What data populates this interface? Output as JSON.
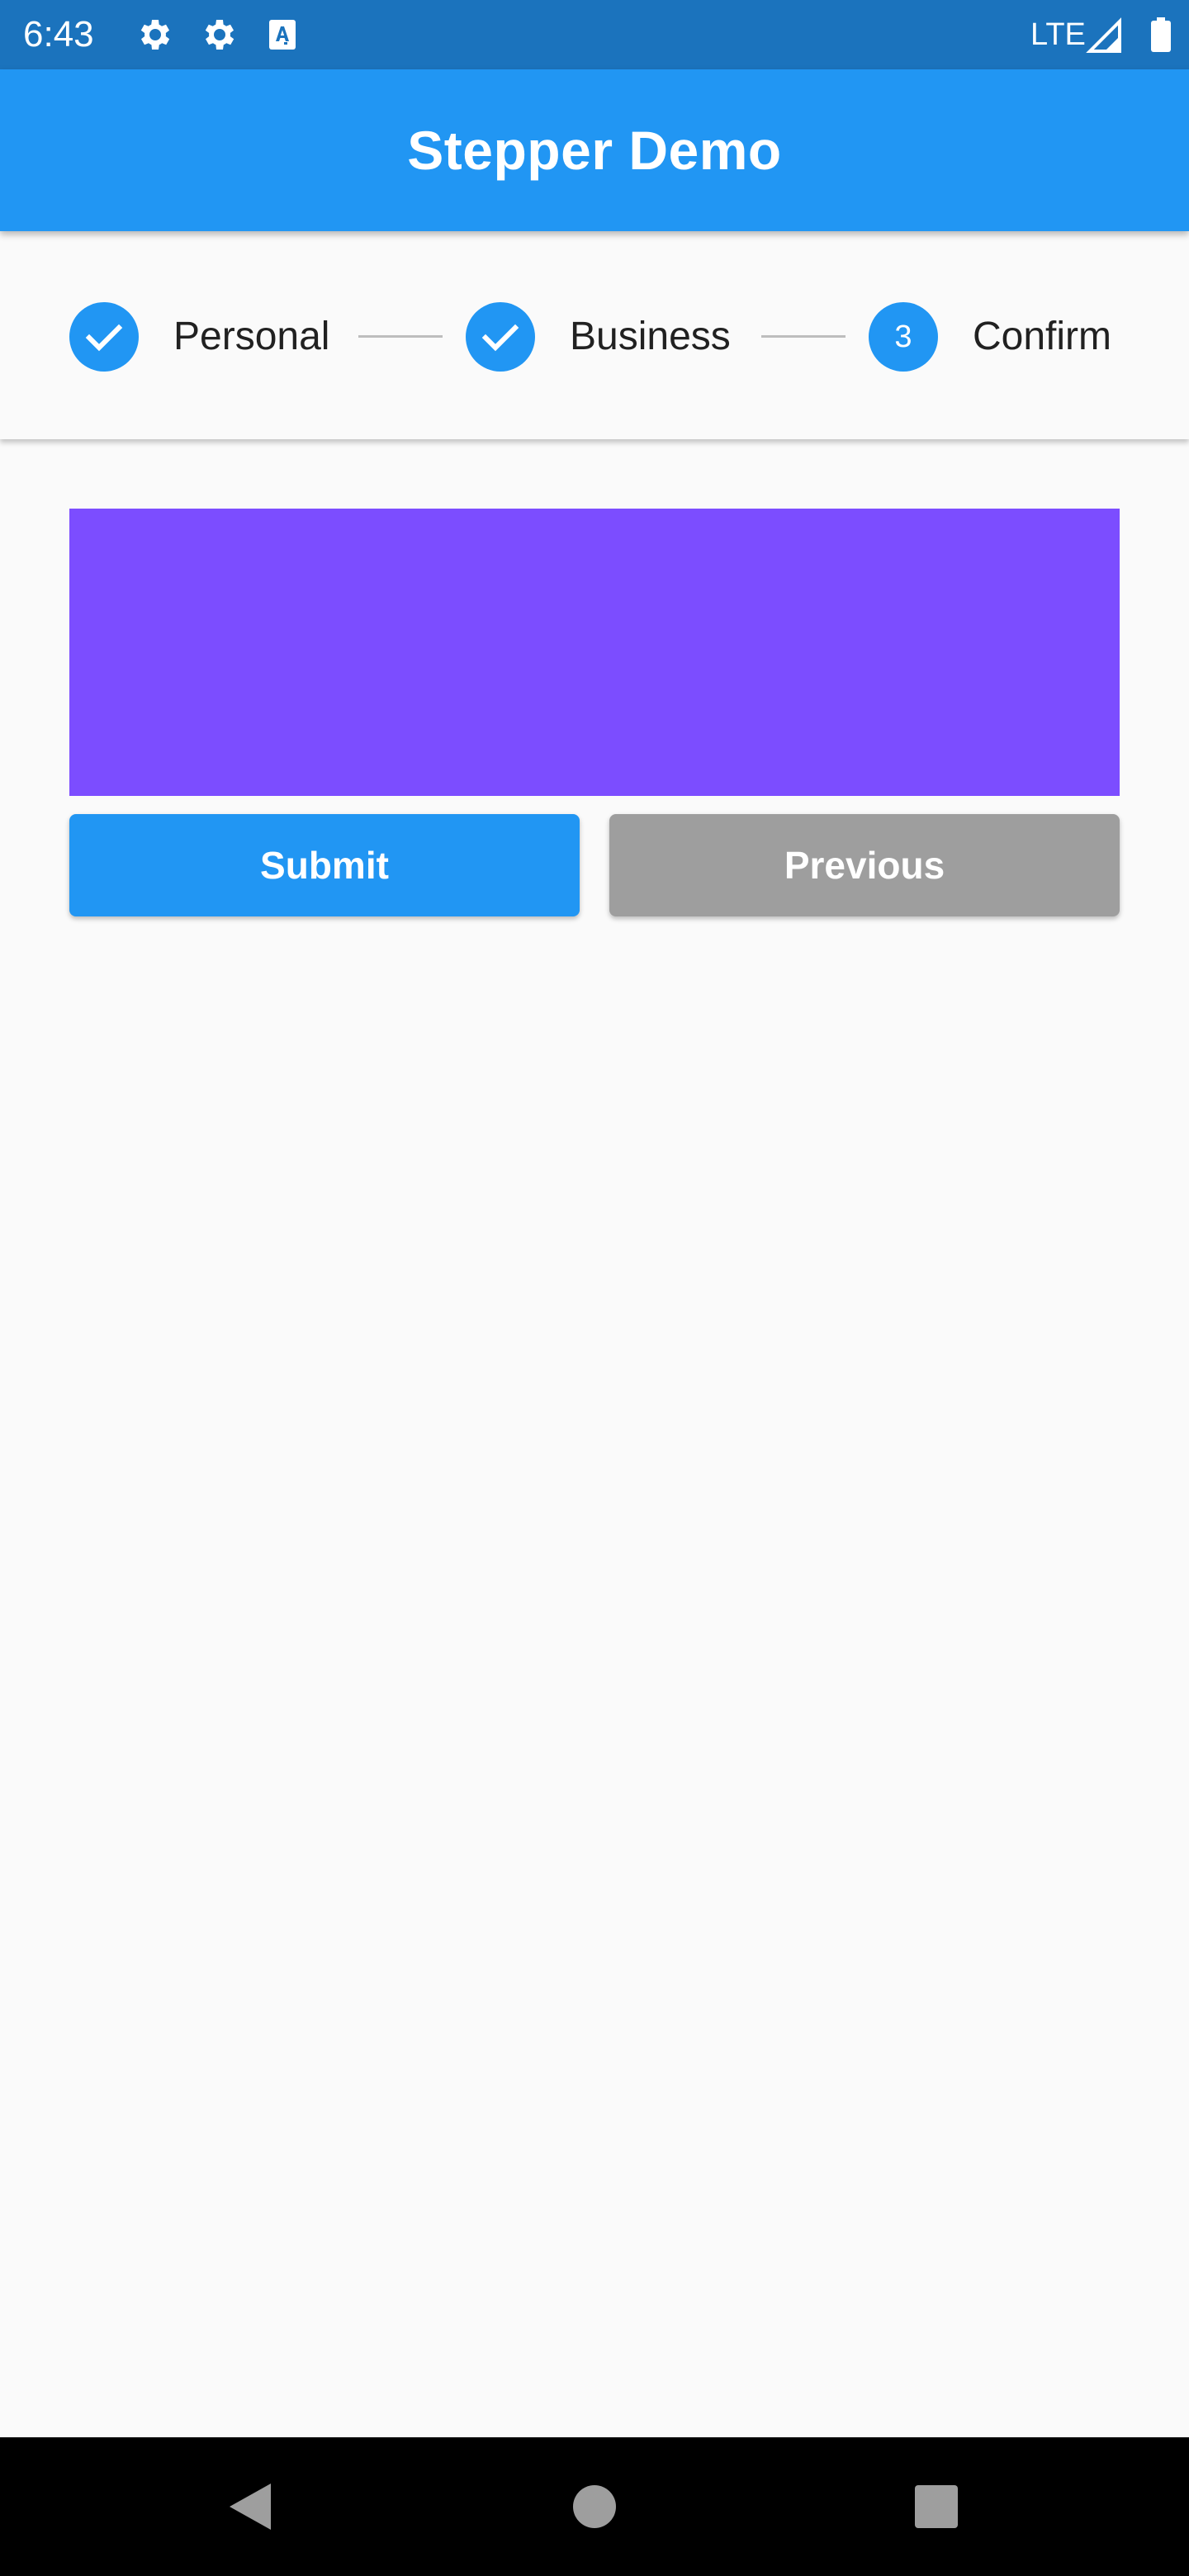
{
  "status_bar": {
    "time": "6:43",
    "network": "LTE",
    "icons": [
      "gear-icon",
      "gear-icon",
      "text-a-icon",
      "signal-icon",
      "battery-icon"
    ],
    "color": "#1b73bd"
  },
  "app_bar": {
    "title": "Stepper Demo",
    "color": "#2196f3"
  },
  "stepper": {
    "steps": [
      {
        "label": "Personal",
        "state": "complete",
        "indicator": "check-icon"
      },
      {
        "label": "Business",
        "state": "complete",
        "indicator": "check-icon"
      },
      {
        "label": "Confirm",
        "state": "active",
        "number": "3"
      }
    ]
  },
  "content": {
    "block_color": "#7c4dff"
  },
  "actions": {
    "submit_label": "Submit",
    "previous_label": "Previous"
  },
  "nav_bar": {
    "buttons": [
      "back-icon",
      "home-icon",
      "recents-icon"
    ]
  }
}
